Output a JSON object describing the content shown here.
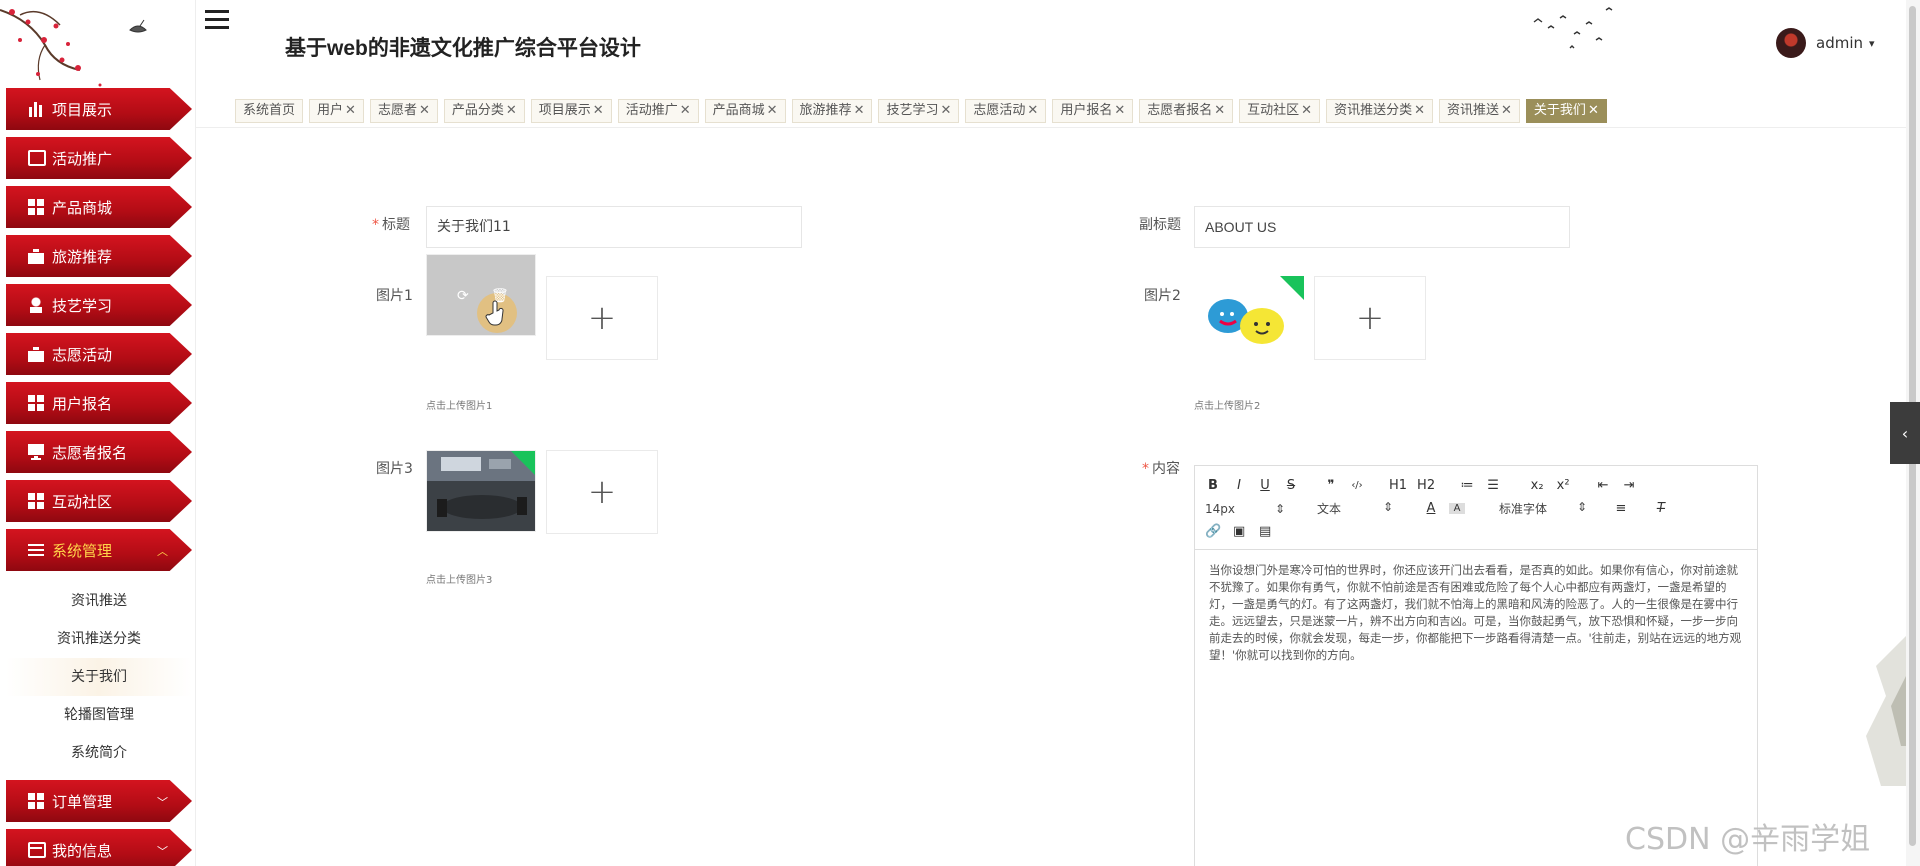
{
  "header": {
    "title": "基于web的非遗文化推广综合平台设计",
    "user_name": "admin",
    "user_caret": "▾"
  },
  "sidebar": {
    "items": [
      {
        "label": "项目展示",
        "icon": "bar-chart-icon"
      },
      {
        "label": "活动推广",
        "icon": "clipboard-icon"
      },
      {
        "label": "产品商城",
        "icon": "grid-icon"
      },
      {
        "label": "旅游推荐",
        "icon": "briefcase-icon"
      },
      {
        "label": "技艺学习",
        "icon": "stamp-icon"
      },
      {
        "label": "志愿活动",
        "icon": "wallet-icon"
      },
      {
        "label": "用户报名",
        "icon": "grid-icon"
      },
      {
        "label": "志愿者报名",
        "icon": "monitor-icon"
      },
      {
        "label": "互动社区",
        "icon": "grid-icon"
      }
    ],
    "system": {
      "label": "系统管理",
      "chevron": "︿",
      "sub_items": [
        "资讯推送",
        "资讯推送分类",
        "关于我们",
        "轮播图管理",
        "系统简介"
      ]
    },
    "orders": {
      "label": "订单管理",
      "chevron": "﹀"
    },
    "mine": {
      "label": "我的信息",
      "chevron": "﹀"
    }
  },
  "tabs": [
    {
      "label": "系统首页",
      "close": ""
    },
    {
      "label": "用户",
      "close": "✕"
    },
    {
      "label": "志愿者",
      "close": "✕"
    },
    {
      "label": "产品分类",
      "close": "✕"
    },
    {
      "label": "项目展示",
      "close": "✕"
    },
    {
      "label": "活动推广",
      "close": "✕"
    },
    {
      "label": "产品商城",
      "close": "✕"
    },
    {
      "label": "旅游推荐",
      "close": "✕"
    },
    {
      "label": "技艺学习",
      "close": "✕"
    },
    {
      "label": "志愿活动",
      "close": "✕"
    },
    {
      "label": "用户报名",
      "close": "✕"
    },
    {
      "label": "志愿者报名",
      "close": "✕"
    },
    {
      "label": "互动社区",
      "close": "✕"
    },
    {
      "label": "资讯推送分类",
      "close": "✕"
    },
    {
      "label": "资讯推送",
      "close": "✕"
    },
    {
      "label": "关于我们",
      "close": "✕"
    }
  ],
  "form": {
    "title_label": "标题",
    "title_required": "*",
    "title_value": "关于我们11",
    "subtitle_label": "副标题",
    "subtitle_value": "ABOUT US",
    "img1_label": "图片1",
    "img1_hint": "点击上传图片1",
    "img2_label": "图片2",
    "img2_hint": "点击上传图片2",
    "img3_label": "图片3",
    "img3_hint": "点击上传图片3",
    "content_label": "内容",
    "content_required": "*",
    "upload_plus": "+"
  },
  "editor": {
    "toolbar_row1": [
      "B",
      "I",
      "U",
      "S",
      "❞",
      "‹/›",
      "H1",
      "H2",
      "≔",
      "☰",
      "x₂",
      "x²",
      "⇤",
      "⇥"
    ],
    "font_size": "14px",
    "text_type": "文本",
    "font_family": "标准字体",
    "select_caret": "⇕",
    "content": "当你设想门外是寒冷可怕的世界时，你还应该开门出去看看，是否真的如此。如果你有信心，你对前途就不犹豫了。如果你有勇气，你就不怕前途是否有困难或危险了每个人心中都应有两盏灯，一盏是希望的灯，一盏是勇气的灯。有了这两盏灯，我们就不怕海上的黑暗和风涛的险恶了。人的一生很像是在雾中行走。远远望去，只是迷蒙一片，辨不出方向和吉凶。可是，当你鼓起勇气，放下恐惧和怀疑，一步一步向前走去的时候，你就会发现，每走一步，你都能把下一步路看得清楚一点。'往前走，别站在远远的地方观望！'你就可以找到你的方向。"
  },
  "misc": {
    "side_tab_glyph": "‹",
    "watermark": "CSDN @辛雨学姐"
  },
  "colors": {
    "menu_red": "#c4101b",
    "active_tab": "#9b8f5a",
    "badge_green": "#19c35b"
  }
}
